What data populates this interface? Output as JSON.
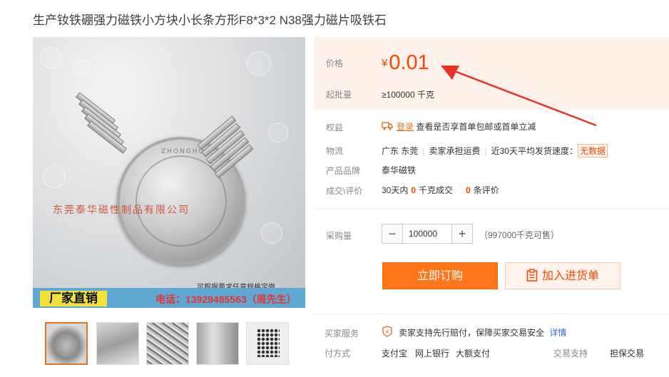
{
  "product": {
    "title": "生产钕铁硼强力磁铁小方块小长条方形F8*3*2 N38强力磁片吸铁石"
  },
  "image": {
    "coin_text": "ZHONGHUA",
    "watermark": "东莞泰华磁性制品有限公司",
    "note": "可根据要求任意规格定做",
    "banner_left": "厂家直销",
    "banner_right": "电话：13929485563（周先生）"
  },
  "thumbnails": [
    "thumb-1",
    "thumb-2",
    "thumb-3",
    "thumb-4",
    "thumb-5"
  ],
  "price": {
    "label": "价格",
    "currency": "¥",
    "value": "0.01",
    "min_label": "起批量",
    "min_value": "≥100000 千克"
  },
  "benefits": {
    "label": "权益",
    "login": "登录",
    "text": "查看是否享首单包邮或首单立减"
  },
  "logistics": {
    "label": "物流",
    "location": "广东 东莞",
    "freight": "卖家承担运费",
    "speed_label": "近30天平均发货速度：",
    "speed_value": "无数据"
  },
  "brand": {
    "label": "产品品牌",
    "value": "泰华磁铁"
  },
  "deals": {
    "label": "成交\\评价",
    "period": "30天内",
    "sold_count": "0",
    "sold_text": "千克成交",
    "review_count": "0",
    "review_text": "条评价"
  },
  "purchase": {
    "label": "采购量",
    "minus": "−",
    "plus": "+",
    "quantity": "100000",
    "available": "（997000千克可售）"
  },
  "buttons": {
    "buy": "立即订购",
    "cart": "加入进货单"
  },
  "service": {
    "label": "买家服务",
    "text": "卖家支持先行赔付，保障买家交易安全",
    "link": "详情"
  },
  "payment": {
    "label": "付方式",
    "methods": [
      "支付宝",
      "网上银行",
      "大额支付"
    ],
    "trade_label": "交易支持",
    "trade_value": "担保交易"
  },
  "colors": {
    "accent": "#ff4400",
    "button": "#ff7519",
    "price_bg": "#fdf1e9"
  }
}
